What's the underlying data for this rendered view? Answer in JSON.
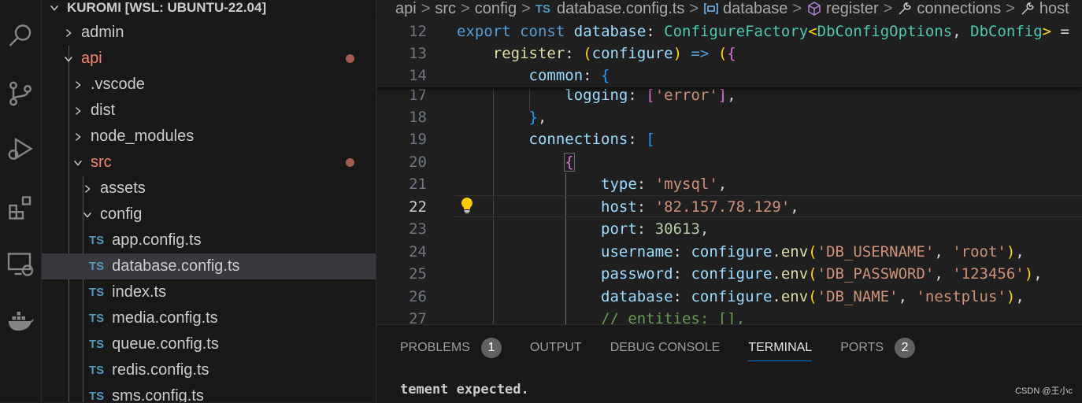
{
  "explorer": {
    "root": "KUROMI [WSL: UBUNTU-22.04]",
    "items": [
      {
        "label": "admin"
      },
      {
        "label": "api"
      },
      {
        "label": ".vscode"
      },
      {
        "label": "dist"
      },
      {
        "label": "node_modules"
      },
      {
        "label": "src"
      },
      {
        "label": "assets"
      },
      {
        "label": "config"
      },
      {
        "label": "app.config.ts"
      },
      {
        "label": "database.config.ts"
      },
      {
        "label": "index.ts"
      },
      {
        "label": "media.config.ts"
      },
      {
        "label": "queue.config.ts"
      },
      {
        "label": "redis.config.ts"
      },
      {
        "label": "sms.config.ts"
      }
    ],
    "ts_badge": "TS"
  },
  "breadcrumb": {
    "items": [
      "api",
      "src",
      "config",
      "database.config.ts",
      "database",
      "register",
      "connections",
      "host"
    ],
    "separator": ">"
  },
  "editor": {
    "line_numbers": [
      "12",
      "13",
      "14",
      "17",
      "18",
      "19",
      "20",
      "21",
      "22",
      "23",
      "24",
      "25",
      "26",
      "27"
    ],
    "active_line": "22"
  },
  "panel": {
    "tabs": [
      {
        "label": "PROBLEMS",
        "badge": "1"
      },
      {
        "label": "OUTPUT"
      },
      {
        "label": "DEBUG CONSOLE"
      },
      {
        "label": "TERMINAL"
      },
      {
        "label": "PORTS",
        "badge": "2"
      }
    ],
    "active_tab": "TERMINAL",
    "terminal_text": "tement expected."
  },
  "watermark": "CSDN @王小c",
  "icons": [
    "search-icon",
    "source-control-icon",
    "run-debug-icon",
    "extensions-icon",
    "remote-explorer-icon",
    "docker-icon",
    "lightbulb-icon"
  ],
  "colors": {
    "accent": "#0078d4",
    "modified": "#f48771",
    "ts": "#519aba"
  }
}
